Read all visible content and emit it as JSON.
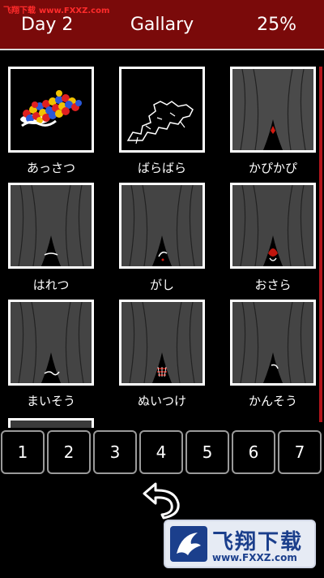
{
  "watermark_top": {
    "name": "飞翔下载",
    "url": "www.FXXZ.com"
  },
  "header": {
    "day": "Day 2",
    "title": "Gallary",
    "progress": "25%"
  },
  "gallery": {
    "items": [
      {
        "label": "あっさつ"
      },
      {
        "label": "ばらばら"
      },
      {
        "label": "かぴかぴ"
      },
      {
        "label": "はれつ"
      },
      {
        "label": "がし"
      },
      {
        "label": "おさら"
      },
      {
        "label": "まいそう"
      },
      {
        "label": "ぬいつけ"
      },
      {
        "label": "かんそう"
      }
    ]
  },
  "pages": [
    "1",
    "2",
    "3",
    "4",
    "5",
    "6",
    "7"
  ],
  "watermark_bottom": {
    "name": "飞翔下载",
    "url": "www.FXXZ.com"
  },
  "colors": {
    "header_bg": "#7a0a0a",
    "accent_red": "#b3151b",
    "tile_gray": "#444444"
  }
}
